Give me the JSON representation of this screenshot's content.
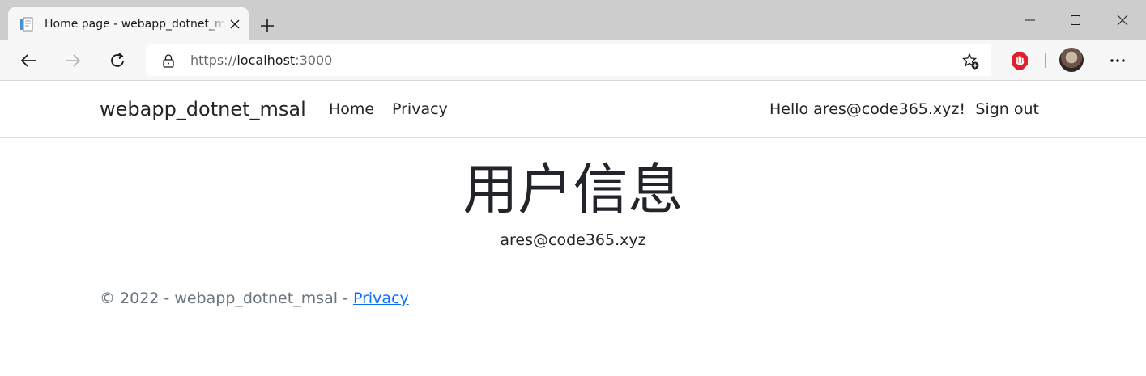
{
  "browser": {
    "tab": {
      "title": "Home page - webapp_dotnet_msal"
    },
    "address": {
      "scheme": "https://",
      "host": "localhost",
      "port": ":3000"
    }
  },
  "site": {
    "brand": "webapp_dotnet_msal",
    "nav": {
      "home": "Home",
      "privacy": "Privacy"
    },
    "auth": {
      "greeting": "Hello ares@code365.xyz!",
      "sign_out": "Sign out"
    },
    "main": {
      "title": "用户信息",
      "email": "ares@code365.xyz"
    },
    "footer": {
      "text": "© 2022 - webapp_dotnet_msal - ",
      "privacy_link": "Privacy"
    }
  },
  "colors": {
    "tabstrip": "#cdcdcd",
    "toolbar": "#f7f7f7",
    "link": "#0d6efd",
    "muted": "#6c757d",
    "text": "#212529",
    "extension_red": "#e0202e"
  },
  "icons": [
    "page-favicon-icon",
    "close-icon",
    "plus-icon",
    "minimize-icon",
    "maximize-icon",
    "window-close-icon",
    "back-arrow-icon",
    "forward-arrow-icon",
    "refresh-icon",
    "lock-icon",
    "favorites-add-icon",
    "stop-extension-icon",
    "profile-avatar",
    "more-menu-icon"
  ]
}
